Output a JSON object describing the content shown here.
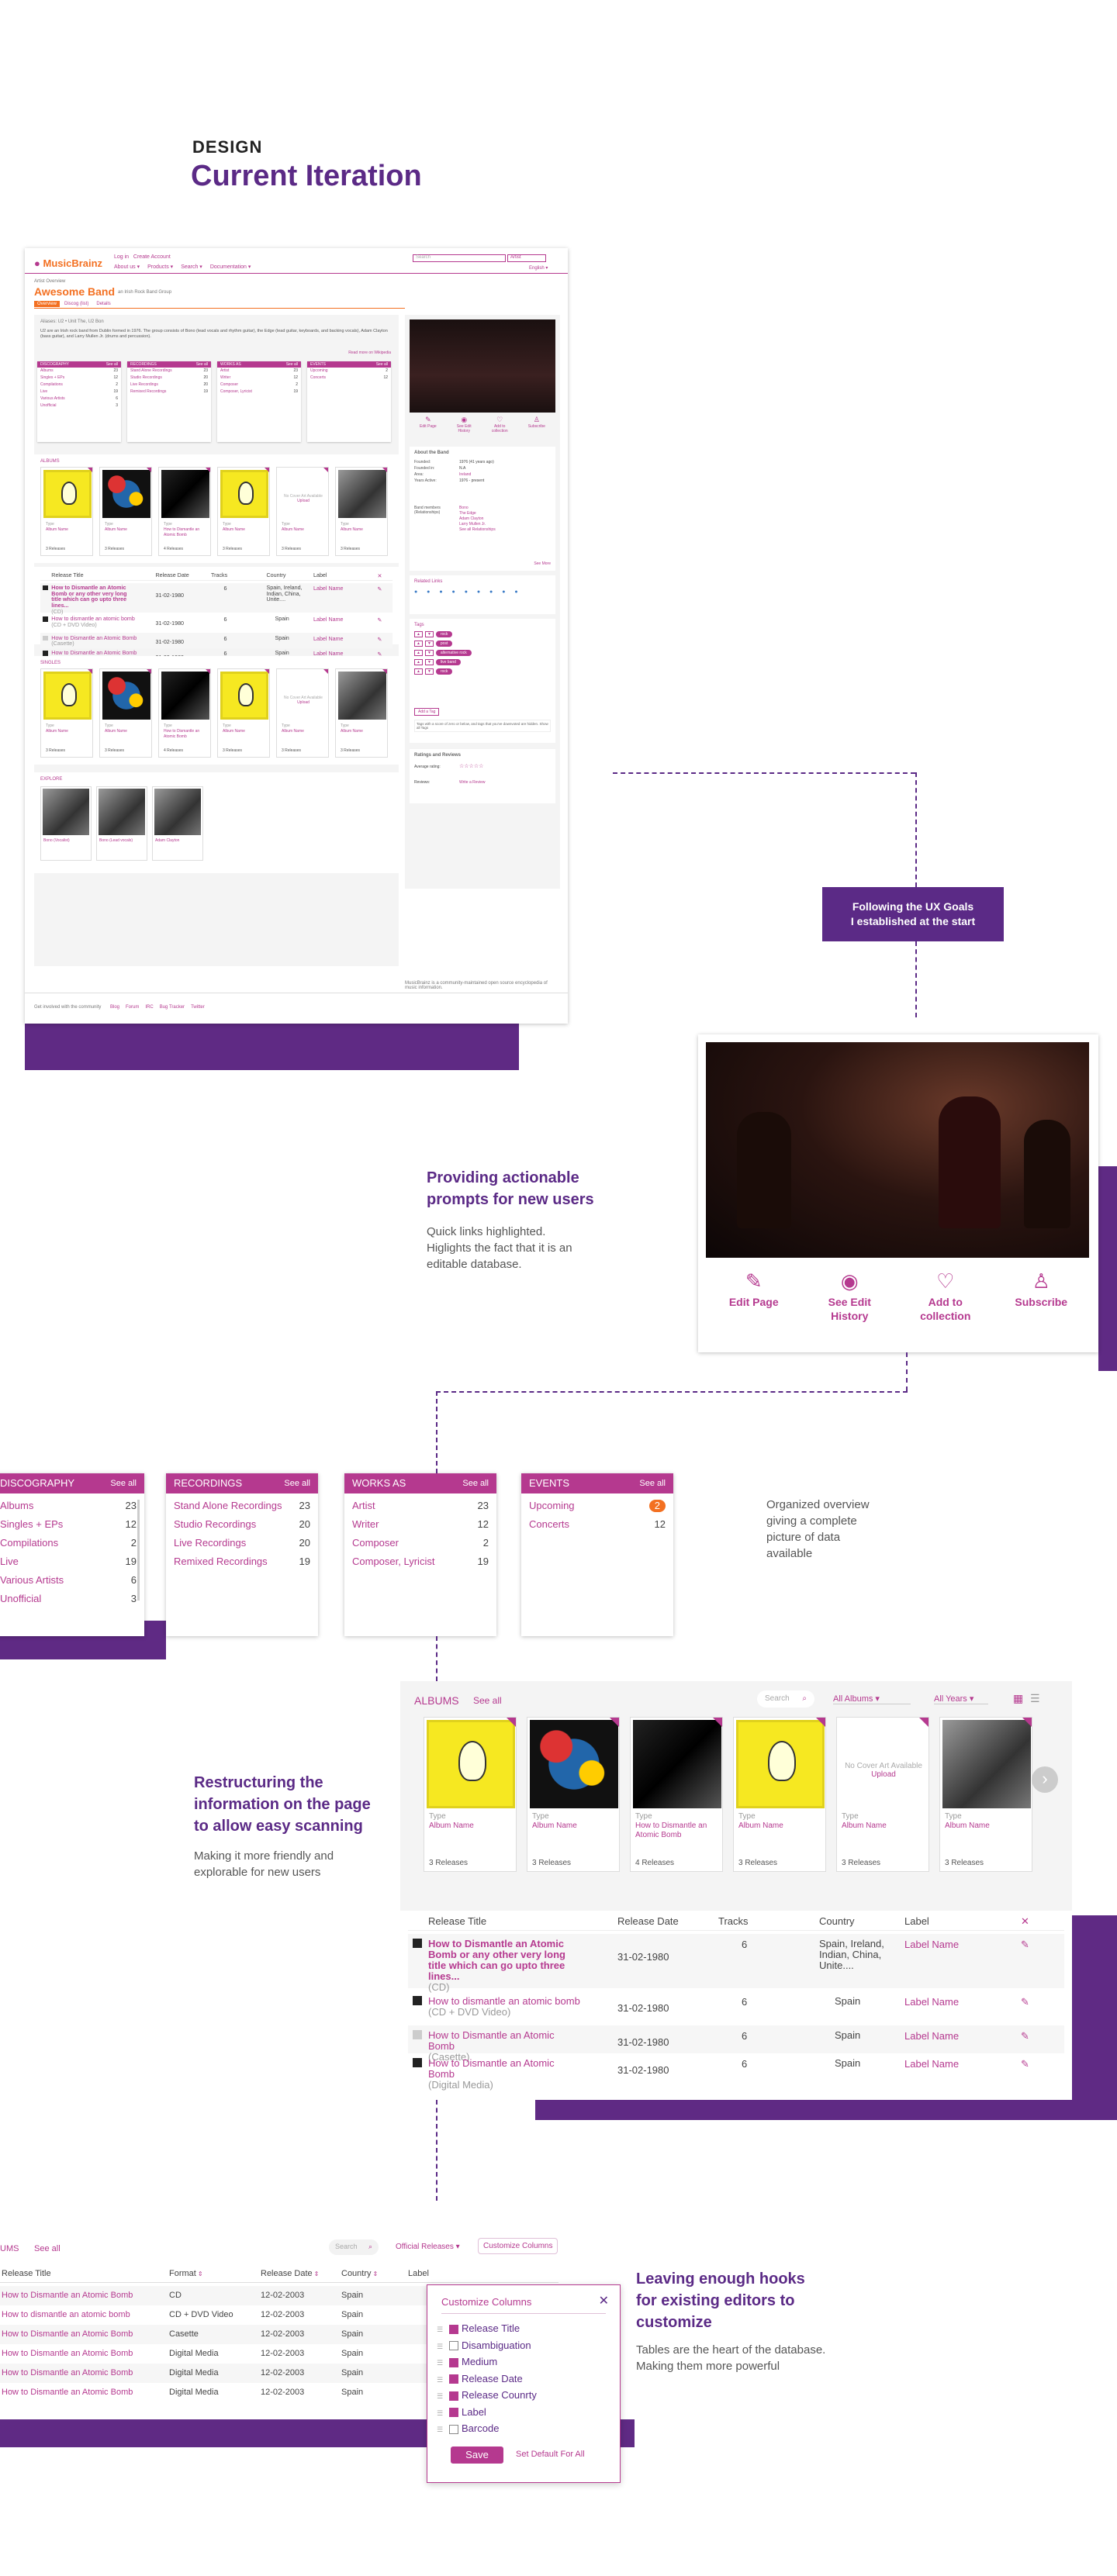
{
  "header": {
    "eyebrow": "DESIGN",
    "title": "Current Iteration"
  },
  "mockup": {
    "logo": "MusicBrainz",
    "top_links": [
      "Log in",
      "Create Account"
    ],
    "nav": [
      "About us ▾",
      "Products ▾",
      "Search ▾",
      "Documentation ▾"
    ],
    "search_placeholder": "Search",
    "search_type": "Artist",
    "language": "English ▾",
    "breadcrumb": "Artist Overview",
    "artist": "Awesome Band",
    "artist_sub": "an Irish Rock Band Group",
    "tabs": [
      "Overview",
      "Discog (list)",
      "Details"
    ],
    "alias": "Aliases: U2 • Unit The, U2 Bon",
    "bio": "U2 are an Irish rock band from Dublin formed in 1976. The group consists of Bono (lead vocals and rhythm guitar), the Edge (lead guitar, keyboards, and backing vocals), Adam Clayton (bass guitar), and Larry Mullen Jr. (drums and percussion).",
    "read_more": "Read more on Wikipedia",
    "about_title": "About the Band",
    "about": [
      [
        "Founded:",
        "1976 (41 years ago)"
      ],
      [
        "Founded in:",
        "N.A"
      ],
      [
        "Area:",
        "Ireland"
      ],
      [
        "Years Active:",
        "1976 - present"
      ]
    ],
    "members_label": "Band members (Relationships)",
    "members": [
      "Bono",
      "The Edge",
      "Adam Clayton",
      "Larry Mullen Jr."
    ],
    "see_all_rel": "See all Relationships",
    "see_more": "See More",
    "related_links": "Related Links",
    "tags_title": "Tags",
    "tags": [
      "rock",
      "post",
      "alternative rock",
      "live band",
      "rock"
    ],
    "add_tag": "Add a Tag",
    "tags_note": "Tags with a score of zero or below, and tags that you've downvoted are hidden. Show all Tags",
    "ratings_title": "Ratings and Reviews",
    "avg_rating": "Average rating:",
    "reviews": "Reviews:",
    "write_review": "Write a Review",
    "releases_tab": "Releases",
    "singles_title": "SINGLES",
    "explore_title": "EXPLORE",
    "explore_items": [
      "Bono (Vocalist)",
      "Bono (Lead vocals)",
      "Adam Clayton"
    ],
    "footer_left": "Get involved with the community",
    "footer_links": [
      "Blog",
      "Forum",
      "IRC",
      "Bug Tracker",
      "Twitter"
    ],
    "footer_right": "MusicBrainz is a community-maintained open source encyclopedia of music information."
  },
  "callout_goals": "Following the UX Goals\nI established at the start",
  "section1": {
    "heading": "Providing actionable\nprompts for new users",
    "body": "Quick links highlighted.\nHiglights the fact that it is an\neditable database.",
    "actions": [
      {
        "icon": "pencil-icon",
        "label": "Edit Page"
      },
      {
        "icon": "eye-icon",
        "label": "See Edit\nHistory"
      },
      {
        "icon": "heart-icon",
        "label": "Add to\ncollection"
      },
      {
        "icon": "user-icon",
        "label": "Subscribe"
      }
    ]
  },
  "section2": {
    "body": "Organized overview\ngiving a complete\npicture of data\navailable",
    "boxes": [
      {
        "title": "DISCOGRAPHY",
        "see": "See all",
        "rows": [
          [
            "Albums",
            "23"
          ],
          [
            "Singles + EPs",
            "12"
          ],
          [
            "Compilations",
            "2"
          ],
          [
            "Live",
            "19"
          ],
          [
            "Various Artists",
            "6"
          ],
          [
            "Unofficial",
            "3"
          ]
        ]
      },
      {
        "title": "RECORDINGS",
        "see": "See all",
        "rows": [
          [
            "Stand Alone Recordings",
            "23"
          ],
          [
            "Studio Recordings",
            "20"
          ],
          [
            "Live Recordings",
            "20"
          ],
          [
            "Remixed Recordings",
            "19"
          ]
        ]
      },
      {
        "title": "WORKS AS",
        "see": "See all",
        "rows": [
          [
            "Artist",
            "23"
          ],
          [
            "Writer",
            "12"
          ],
          [
            "Composer",
            "2"
          ],
          [
            "Composer, Lyricist",
            "19"
          ]
        ]
      },
      {
        "title": "EVENTS",
        "see": "See all",
        "rows": [
          [
            "Upcoming",
            "2"
          ],
          [
            "Concerts",
            "12"
          ]
        ]
      }
    ]
  },
  "section3": {
    "heading": "Restructuring the\ninformation on the page\nto allow easy scanning",
    "body": "Making it more friendly and\nexplorable for new users",
    "albums_title": "ALBUMS",
    "see_all": "See all",
    "search_placeholder": "Search",
    "filter1": "All Albums ▾",
    "filter2": "All Years ▾",
    "covers": [
      {
        "type": "Type",
        "name": "Album Name",
        "count": "3 Releases"
      },
      {
        "type": "Type",
        "name": "Album Name",
        "count": "3 Releases"
      },
      {
        "type": "Type",
        "name": "How to Dismantle an Atomic Bomb",
        "count": "4 Releases"
      },
      {
        "type": "Type",
        "name": "Album Name",
        "count": "3 Releases"
      },
      {
        "type": "Type",
        "name": "Album Name",
        "count": "3 Releases"
      },
      {
        "type": "Type",
        "name": "Album Name",
        "count": "3 Releases"
      }
    ],
    "no_cover": "No Cover Art Available",
    "upload": "Upload",
    "table_headers": [
      "Release Title",
      "Release Date",
      "Tracks",
      "Country",
      "Label"
    ],
    "rows": [
      {
        "title": "How to Dismantle an Atomic Bomb or any other very long title which can go upto three lines...",
        "fmt": "(CD)",
        "date": "31-02-1980",
        "tracks": "6",
        "country": "Spain, Ireland, Indian, China, Unite....",
        "label": "Label Name"
      },
      {
        "title": "How to dismantle an atomic bomb",
        "fmt": "(CD + DVD Video)",
        "date": "31-02-1980",
        "tracks": "6",
        "country": "Spain",
        "label": "Label Name"
      },
      {
        "title": "How to Dismantle an Atomic Bomb",
        "fmt": "(Casette)",
        "date": "31-02-1980",
        "tracks": "6",
        "country": "Spain",
        "label": "Label Name"
      },
      {
        "title": "How to Dismantle an Atomic Bomb",
        "fmt": "(Digital Media)",
        "date": "31-02-1980",
        "tracks": "6",
        "country": "Spain",
        "label": "Label Name"
      }
    ]
  },
  "section4": {
    "heading": "Leaving enough hooks\nfor existing editors to\ncustomize",
    "body": "Tables are the heart of the database.\nMaking them more powerful",
    "albums_title": "UMS",
    "see_all": "See all",
    "search_placeholder": "Search",
    "filter": "Official Releases ▾",
    "customize": "Customize Columns",
    "headers": [
      "Release Title",
      "Format",
      "Release Date",
      "Country",
      "Label"
    ],
    "rows": [
      [
        "How to Dismantle an Atomic Bomb",
        "CD",
        "12-02-2003",
        "Spain"
      ],
      [
        "How to dismantle an atomic bomb",
        "CD + DVD Video",
        "12-02-2003",
        "Spain"
      ],
      [
        "How to Dismantle an Atomic Bomb",
        "Casette",
        "12-02-2003",
        "Spain"
      ],
      [
        "How to Dismantle an Atomic Bomb",
        "Digital Media",
        "12-02-2003",
        "Spain"
      ],
      [
        "How to Dismantle an Atomic Bomb",
        "Digital Media",
        "12-02-2003",
        "Spain"
      ],
      [
        "How to Dismantle an Atomic Bomb",
        "Digital Media",
        "12-02-2003",
        "Spain"
      ]
    ],
    "popup_title": "Customize Columns",
    "options": [
      {
        "label": "Release Title",
        "on": true
      },
      {
        "label": "Disambiguation",
        "on": false
      },
      {
        "label": "Medium",
        "on": true
      },
      {
        "label": "Release Date",
        "on": true
      },
      {
        "label": "Release Counrty",
        "on": true
      },
      {
        "label": "Label",
        "on": true
      },
      {
        "label": "Barcode",
        "on": false
      }
    ],
    "save": "Save",
    "set_default": "Set Default For All"
  },
  "colors": {
    "accent": "#b5398f",
    "brand": "#5f2a84",
    "orange": "#f37021"
  }
}
